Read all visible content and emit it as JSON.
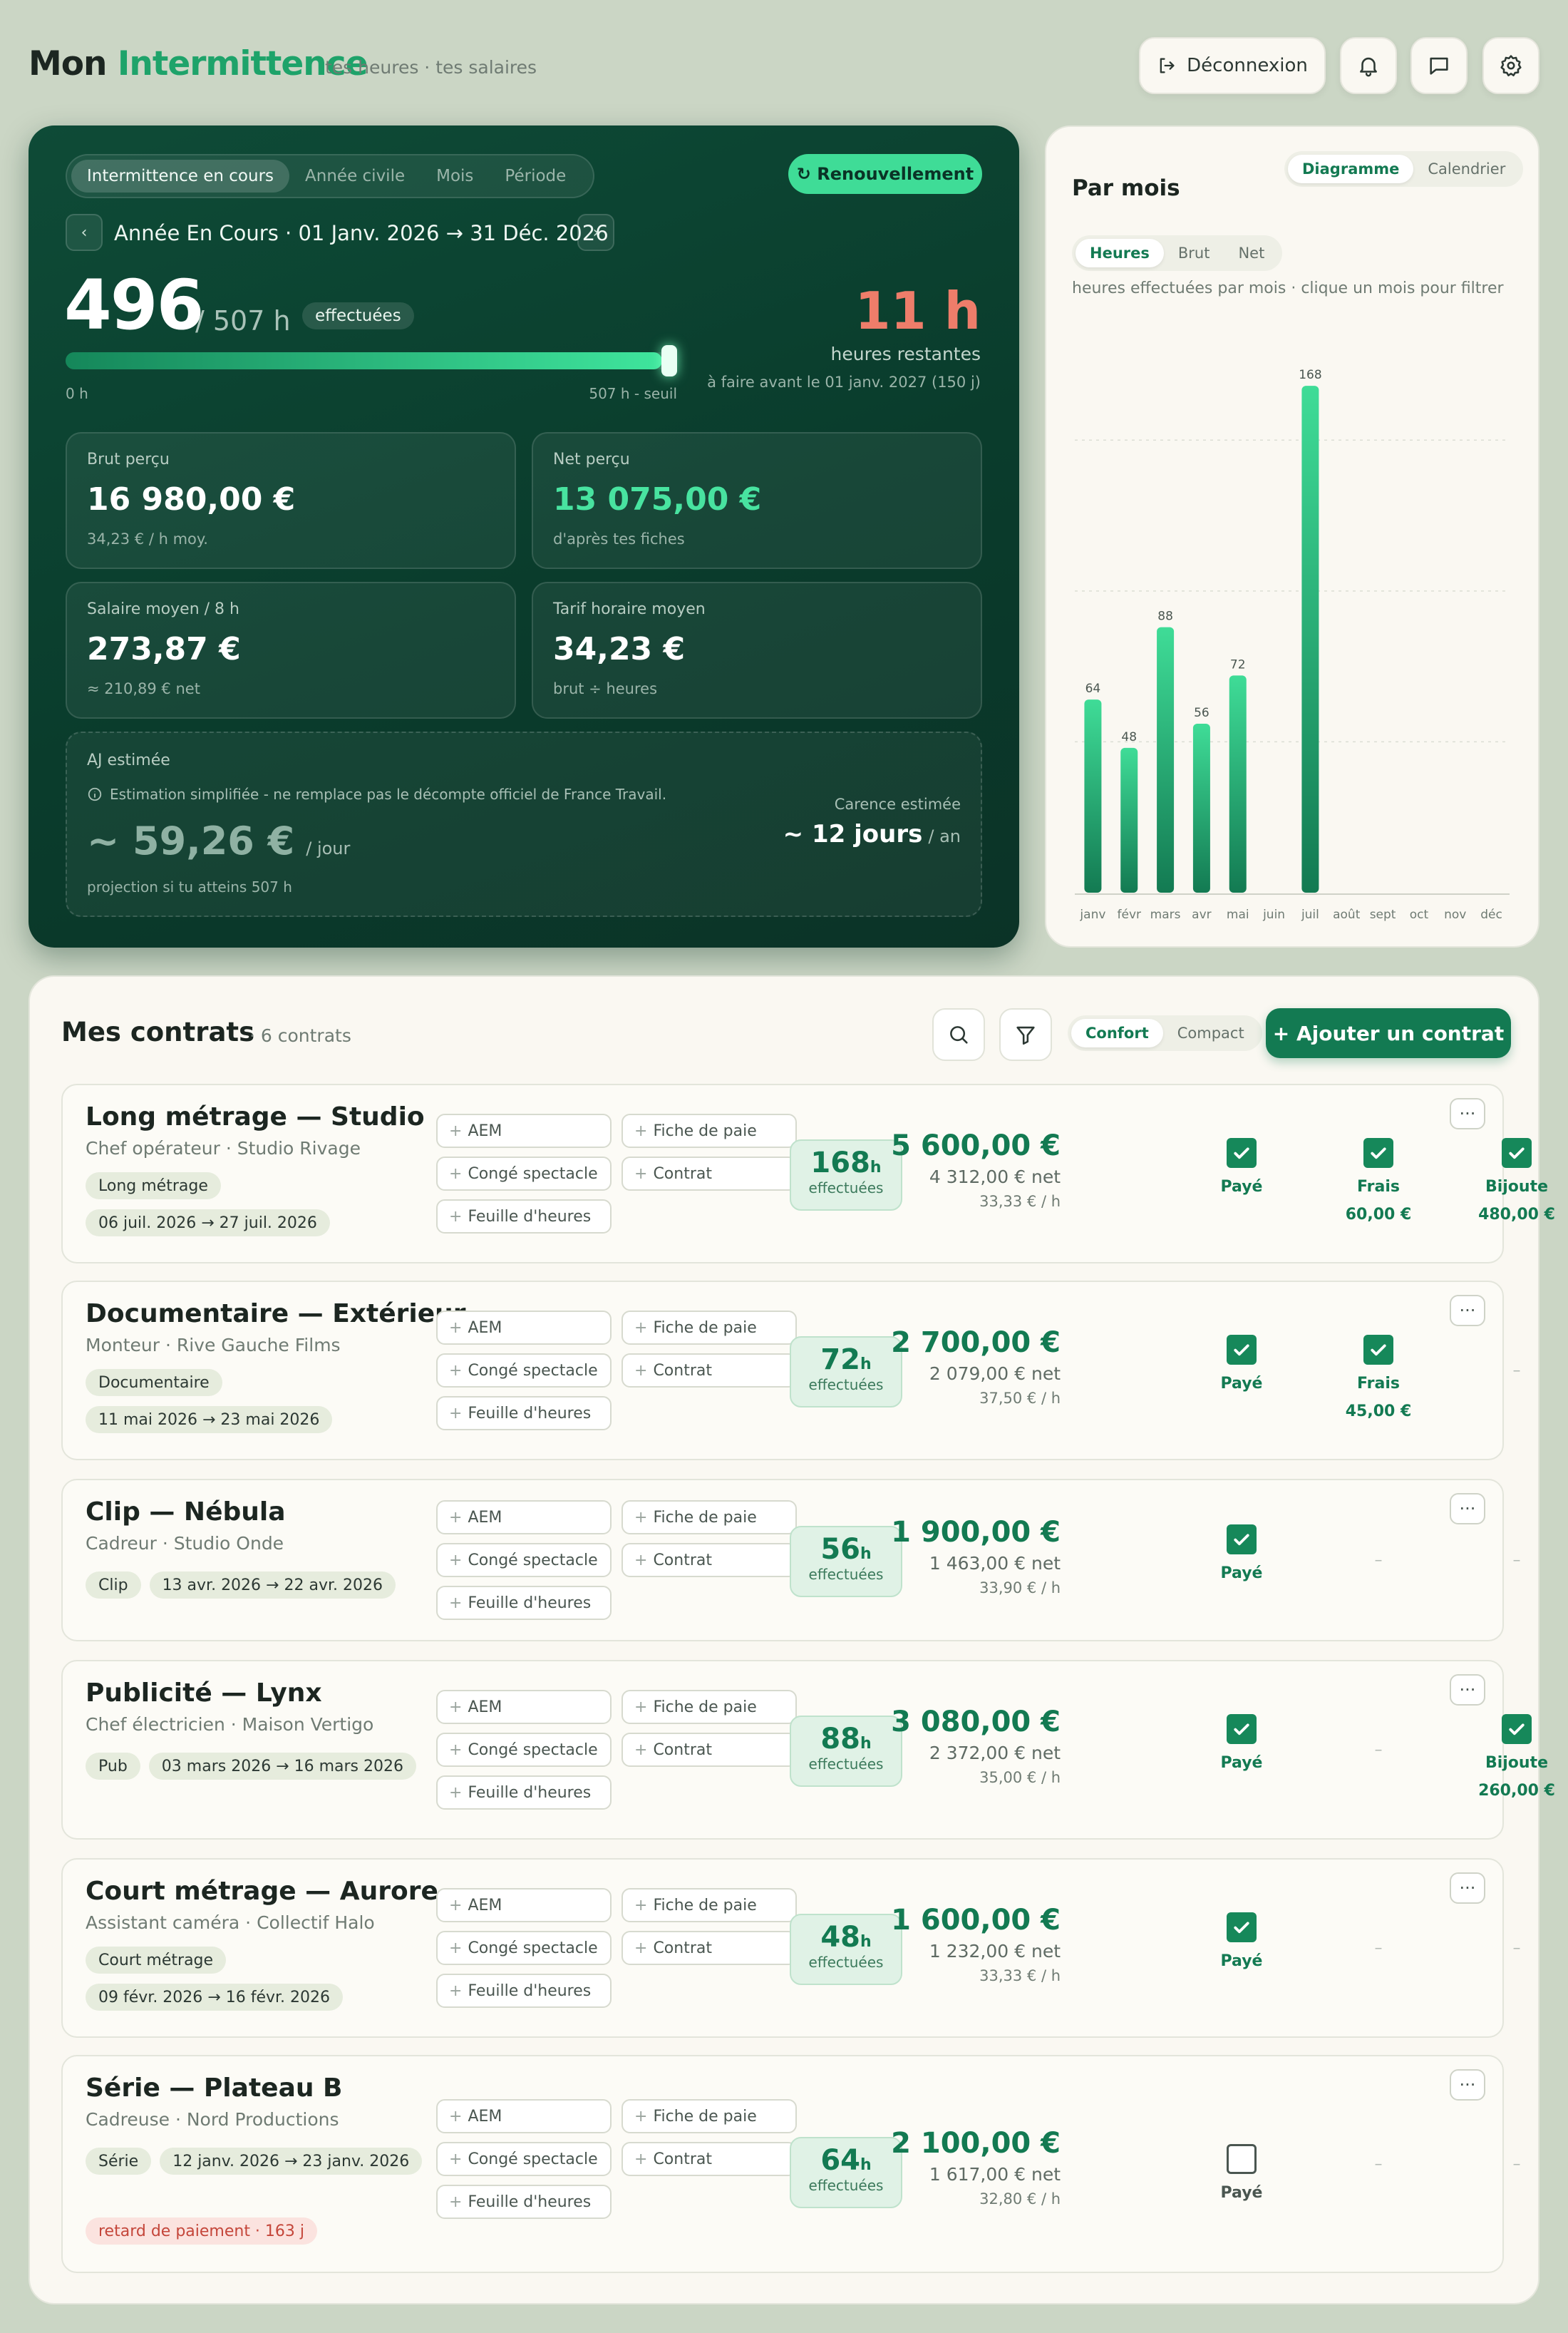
{
  "header": {
    "title_main": "Mon",
    "title_accent": "Intermittence",
    "subtitle": "tes heures · tes salaires",
    "logout_label": "Déconnexion",
    "icons": [
      "bell-icon",
      "message-icon",
      "gear-icon"
    ]
  },
  "hero": {
    "tabs": [
      "Intermittence en cours",
      "Année civile",
      "Mois",
      "Période"
    ],
    "renew_label": "↻ Renouvellement",
    "period_label": "Année En Cours · 01 Janv. 2026 → 31 Déc. 2026",
    "hours_done": "496",
    "hours_total": "/ 507 h",
    "done_badge": "effectuées",
    "progress": 0.978,
    "scale_min": "0 h",
    "scale_max": "507 h - seuil",
    "remaining": "11 h",
    "remaining_label": "heures restantes",
    "remaining_deadline": "à faire avant le 01 janv. 2027 (150 j)",
    "cards": [
      {
        "label": "Brut perçu",
        "value": "16 980,00 €",
        "sub": "34,23 € / h moy."
      },
      {
        "label": "Net perçu",
        "value": "13 075,00 €",
        "sub": "d'après tes fiches"
      },
      {
        "label": "Salaire moyen / 8 h",
        "value": "273,87 €",
        "sub": "≈ 210,89 € net"
      },
      {
        "label": "Tarif horaire moyen",
        "value": "34,23 €",
        "sub": "brut ÷ heures"
      }
    ],
    "aj": {
      "label": "AJ estimée",
      "info": "Estimation simplifiée - ne remplace pas le décompte officiel de France Travail.",
      "value": "~ 59,26 €",
      "unit": "/ jour",
      "note": "projection si tu atteins 507 h",
      "carence_label": "Carence estimée",
      "carence_value": "~ 12 jours",
      "carence_unit": "/ an"
    }
  },
  "chart_panel": {
    "title": "Par mois",
    "view_toggle": [
      "Diagramme",
      "Calendrier"
    ],
    "metric_toggle": [
      "Heures",
      "Brut",
      "Net"
    ],
    "caption": "heures effectuées par mois · clique un mois pour filtrer"
  },
  "chart_data": {
    "type": "bar",
    "categories": [
      "janv",
      "févr",
      "mars",
      "avr",
      "mai",
      "juin",
      "juil",
      "août",
      "sept",
      "oct",
      "nov",
      "déc"
    ],
    "values": [
      64,
      48,
      88,
      56,
      72,
      0,
      168,
      0,
      0,
      0,
      0,
      0
    ],
    "ylim": [
      0,
      190
    ],
    "grid": true,
    "colors": {
      "bar_top": "#3fdc97",
      "bar_bottom": "#137a52"
    }
  },
  "contracts_panel": {
    "title": "Mes contrats",
    "count": "· 6 contrats",
    "density": [
      "Confort",
      "Compact"
    ],
    "add_label": "+ Ajouter un contrat",
    "doc_labels": {
      "aem": "AEM",
      "fiche": "Fiche de paie",
      "conge": "Congé spectacle",
      "contrat": "Contrat",
      "feuille": "Feuille d'heures"
    },
    "hours_unit": "h",
    "hours_label": "effectuées",
    "paid_label": "Payé",
    "frais_label": "Frais",
    "bijoute_label": "Bijoute",
    "empty": "–"
  },
  "contracts": [
    {
      "title": "Long métrage — Studio",
      "role": "Chef opérateur · Studio Rivage",
      "tag": "Long métrage",
      "dates": "06 juil. 2026 → 27 juil. 2026",
      "hours": "168",
      "brut": "5 600,00 €",
      "net": "4 312,00 € net",
      "rate": "33,33 € / h",
      "paid": true,
      "frais": "60,00 €",
      "bijoute": "480,00 €"
    },
    {
      "title": "Documentaire — Extérieur",
      "role": "Monteur · Rive Gauche Films",
      "tag": "Documentaire",
      "dates": "11 mai 2026 → 23 mai 2026",
      "hours": "72",
      "brut": "2 700,00 €",
      "net": "2 079,00 € net",
      "rate": "37,50 € / h",
      "paid": true,
      "frais": "45,00 €",
      "bijoute": null
    },
    {
      "title": "Clip — Nébula",
      "role": "Cadreur · Studio Onde",
      "tag": "Clip",
      "dates": "13 avr. 2026 → 22 avr. 2026",
      "hours": "56",
      "brut": "1 900,00 €",
      "net": "1 463,00 € net",
      "rate": "33,90 € / h",
      "paid": true,
      "frais": null,
      "bijoute": null
    },
    {
      "title": "Publicité — Lynx",
      "role": "Chef électricien · Maison Vertigo",
      "tag": "Pub",
      "dates": "03 mars 2026 → 16 mars 2026",
      "hours": "88",
      "brut": "3 080,00 €",
      "net": "2 372,00 € net",
      "rate": "35,00 € / h",
      "paid": true,
      "frais": null,
      "bijoute": "260,00 €"
    },
    {
      "title": "Court métrage — Aurore",
      "role": "Assistant caméra · Collectif Halo",
      "tag": "Court métrage",
      "dates": "09 févr. 2026 → 16 févr. 2026",
      "hours": "48",
      "brut": "1 600,00 €",
      "net": "1 232,00 € net",
      "rate": "33,33 € / h",
      "paid": true,
      "frais": null,
      "bijoute": null
    },
    {
      "title": "Série — Plateau B",
      "role": "Cadreuse · Nord Productions",
      "tag": "Série",
      "dates": "12 janv. 2026 → 23 janv. 2026",
      "hours": "64",
      "brut": "2 100,00 €",
      "net": "1 617,00 € net",
      "rate": "32,80 € / h",
      "paid": false,
      "frais": null,
      "bijoute": null,
      "alert": "retard de paiement · 163 j"
    }
  ]
}
